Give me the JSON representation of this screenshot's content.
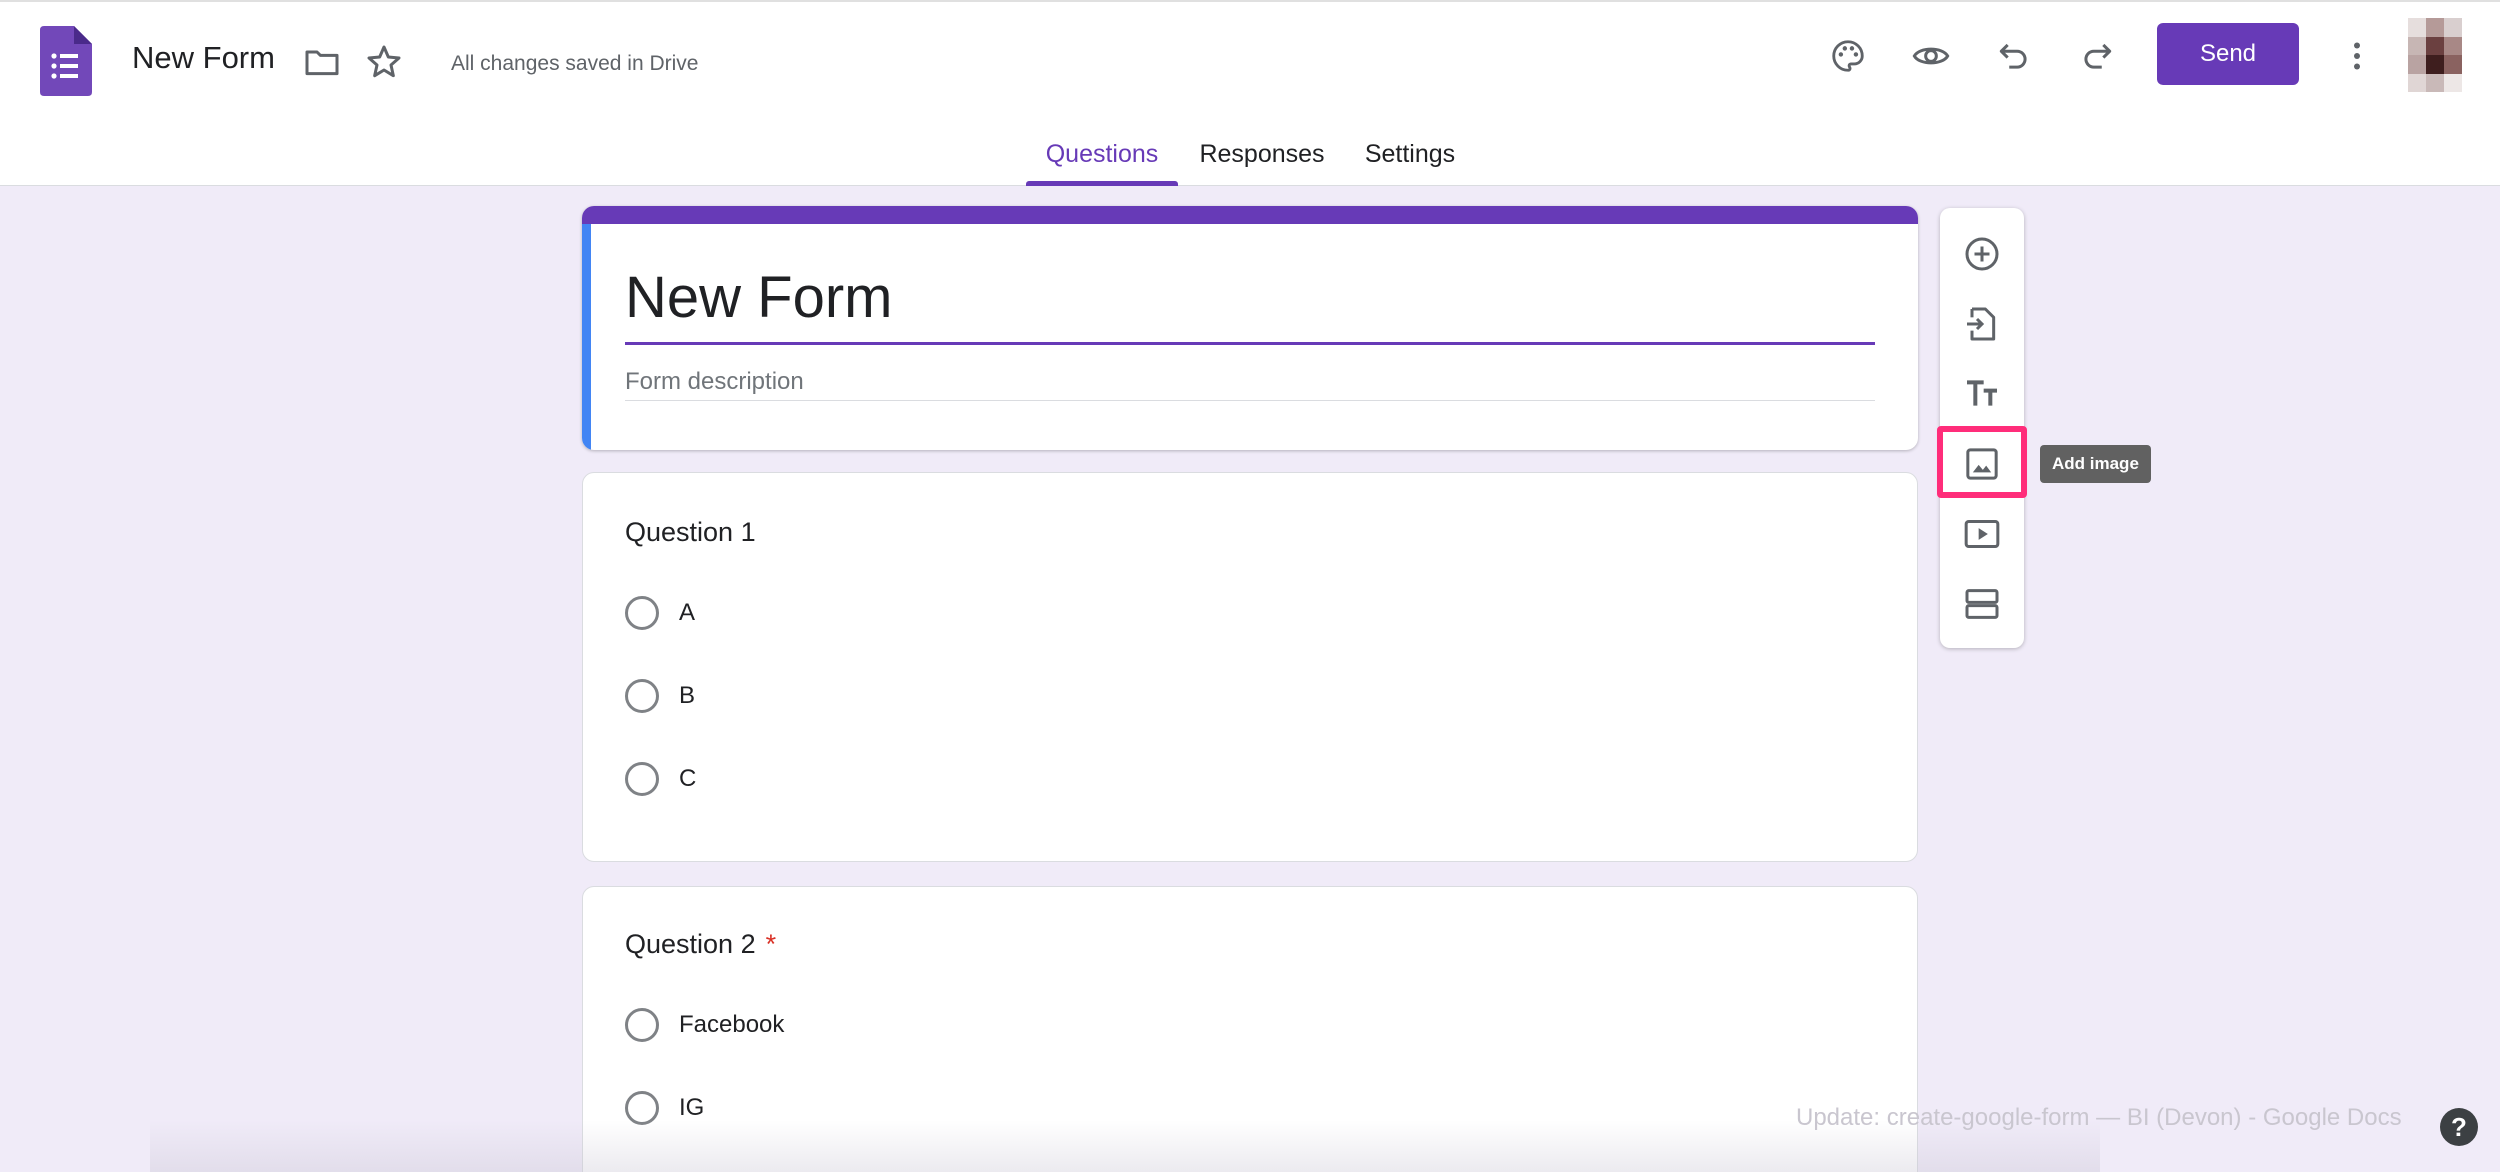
{
  "header": {
    "doc_title": "New Form",
    "save_status": "All changes saved in Drive",
    "send_label": "Send",
    "icons": [
      "forms-logo-icon",
      "folder-icon",
      "star-icon",
      "palette-icon",
      "eye-icon",
      "undo-icon",
      "redo-icon",
      "more-vert-icon"
    ]
  },
  "tabs": [
    {
      "label": "Questions",
      "active": true
    },
    {
      "label": "Responses",
      "active": false
    },
    {
      "label": "Settings",
      "active": false
    }
  ],
  "form": {
    "title": "New Form",
    "description_placeholder": "Form description"
  },
  "questions": [
    {
      "title": "Question 1",
      "required": false,
      "options": [
        "A",
        "B",
        "C"
      ]
    },
    {
      "title": "Question 2",
      "required": true,
      "required_mark": "*",
      "options": [
        "Facebook",
        "IG"
      ]
    }
  ],
  "toolbar": {
    "tools": [
      "add-question-icon",
      "import-questions-icon",
      "add-title-icon",
      "add-image-icon",
      "add-video-icon",
      "add-section-icon"
    ],
    "tooltip": "Add image"
  },
  "overlay": {
    "window_title": "Update: create-google-form — BI (Devon) - Google Docs",
    "help_label": "?"
  },
  "colors": {
    "accent": "#673ab7",
    "background": "#f0ebf8",
    "highlight": "#ff2d7a",
    "left_bar": "#4285f4",
    "required": "#d93025"
  }
}
